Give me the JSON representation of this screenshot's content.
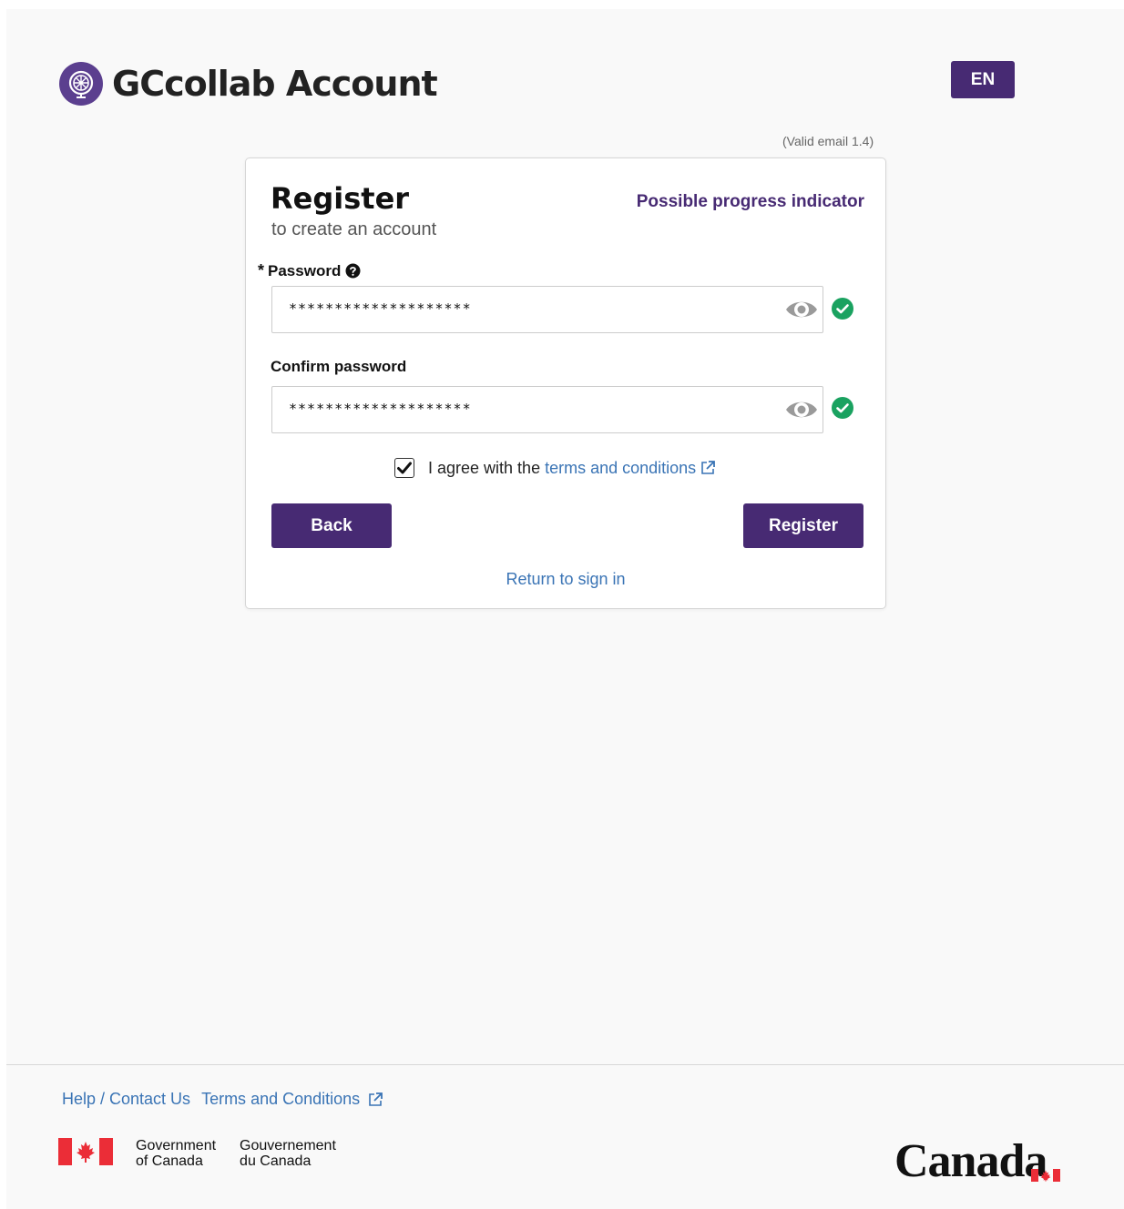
{
  "header": {
    "brand_title": "GCcollab Account",
    "lang_button": "EN"
  },
  "version_note": "(Valid email 1.4)",
  "card": {
    "title": "Register",
    "subtitle": "to create an account",
    "progress_indicator": "Possible progress indicator",
    "password": {
      "required_mark": "*",
      "label": "Password",
      "value": "********************"
    },
    "confirm_password": {
      "label": "Confirm password",
      "value": "********************"
    },
    "agree": {
      "checked": true,
      "prefix": "I agree with the",
      "link": "terms and conditions"
    },
    "back_button": "Back",
    "register_button": "Register",
    "return_link": "Return to sign in"
  },
  "footer": {
    "help_link": "Help / Contact Us",
    "terms_link": "Terms and Conditions",
    "gov_en_line1": "Government",
    "gov_en_line2": "of Canada",
    "gov_fr_line1": "Gouvernement",
    "gov_fr_line2": "du Canada",
    "wordmark": "Canada"
  },
  "colors": {
    "brand_purple": "#472a73",
    "link_blue": "#3a74b5",
    "valid_green": "#1aa260",
    "canada_red": "#eb2d37"
  },
  "icons": [
    "globe-logo-icon",
    "help-circle-icon",
    "eye-icon",
    "check-circle-icon",
    "checkmark-icon",
    "external-link-icon",
    "canada-flag-icon"
  ]
}
